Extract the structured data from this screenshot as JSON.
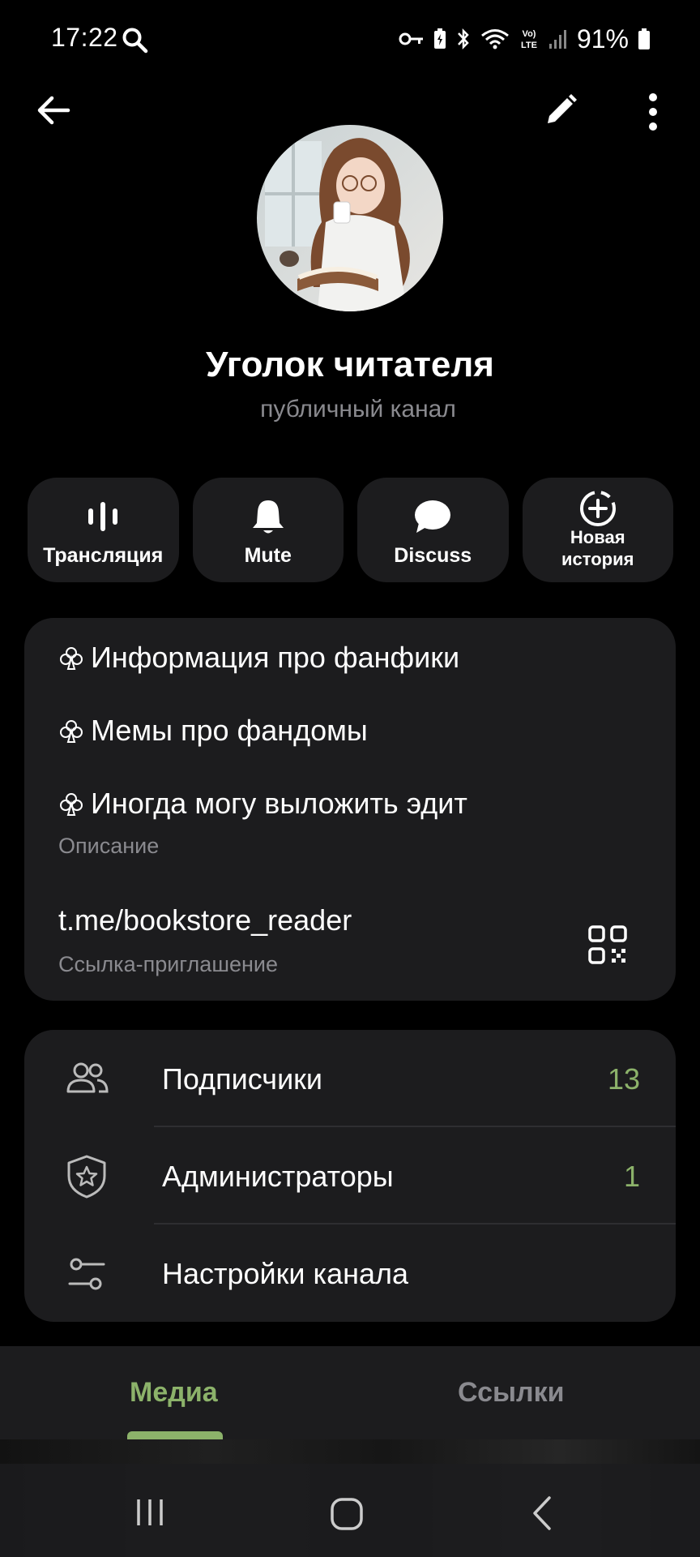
{
  "status_bar": {
    "time": "17:22",
    "battery": "91%"
  },
  "channel": {
    "name": "Уголок читателя",
    "type": "публичный канал"
  },
  "actions": [
    {
      "label": "Трансляция",
      "icon": "live-stream-icon"
    },
    {
      "label": "Mute",
      "icon": "bell-icon"
    },
    {
      "label": "Discuss",
      "icon": "chat-bubble-icon"
    },
    {
      "label_line1": "Новая",
      "label_line2": "история",
      "icon": "add-story-icon"
    }
  ],
  "info": {
    "description_lines": [
      "Информация про фанфики",
      "Мемы про фандомы",
      "Иногда могу выложить эдит"
    ],
    "description_label": "Описание",
    "link": "t.me/bookstore_reader",
    "link_label": "Ссылка-приглашение"
  },
  "menu": [
    {
      "label": "Подписчики",
      "value": "13",
      "icon": "subscribers-icon"
    },
    {
      "label": "Администраторы",
      "value": "1",
      "icon": "admin-shield-icon"
    },
    {
      "label": "Настройки канала",
      "value": "",
      "icon": "settings-sliders-icon"
    }
  ],
  "tabs": {
    "media": "Медиа",
    "links": "Ссылки",
    "active": "media"
  },
  "colors": {
    "accent": "#8cb26a",
    "card": "#1c1c1e",
    "background": "#000000",
    "secondary_text": "#8a8a8f"
  }
}
